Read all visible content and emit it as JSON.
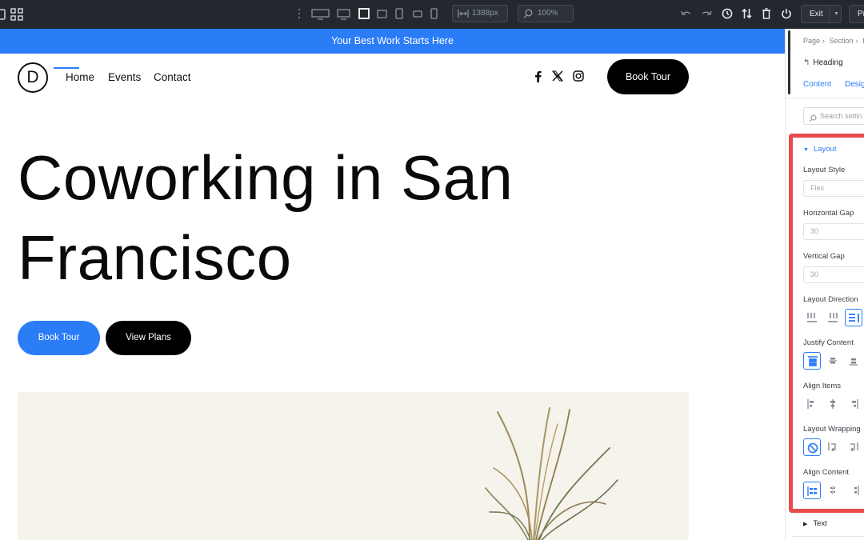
{
  "toolbar": {
    "width_value": "1388px",
    "zoom_value": "100%",
    "exit_label": "Exit",
    "publish_label": "Pr"
  },
  "site": {
    "announcement": "Your Best Work Starts Here",
    "logo_letter": "D",
    "nav": [
      "Home",
      "Events",
      "Contact"
    ],
    "social_icons": [
      "facebook-icon",
      "x-icon",
      "instagram-icon"
    ],
    "header_cta": "Book Tour",
    "hero_title": "Coworking in San Francisco",
    "hero_buttons": {
      "primary": "Book Tour",
      "secondary": "View Plans"
    },
    "accent_color": "#2b7cf7"
  },
  "panel": {
    "breadcrumb": [
      "Page",
      "Section",
      "I"
    ],
    "module_title": "Heading",
    "tabs": {
      "content": "Content",
      "design": "Desig"
    },
    "search_placeholder": "Search settin",
    "layout_group": {
      "title": "Layout",
      "layout_style": {
        "label": "Layout Style",
        "value": "Flex"
      },
      "horizontal_gap": {
        "label": "Horizontal Gap",
        "value": "30"
      },
      "vertical_gap": {
        "label": "Vertical Gap",
        "value": "30"
      },
      "layout_direction": {
        "label": "Layout Direction",
        "selected_index": 2
      },
      "justify_content": {
        "label": "Justify Content",
        "selected_index": 0
      },
      "align_items": {
        "label": "Align Items"
      },
      "layout_wrapping": {
        "label": "Layout Wrapping",
        "selected_index": 0
      },
      "align_content": {
        "label": "Align Content",
        "selected_index": 0
      }
    },
    "text_group": {
      "title": "Text"
    },
    "highlight_color": "#e74c4c"
  }
}
